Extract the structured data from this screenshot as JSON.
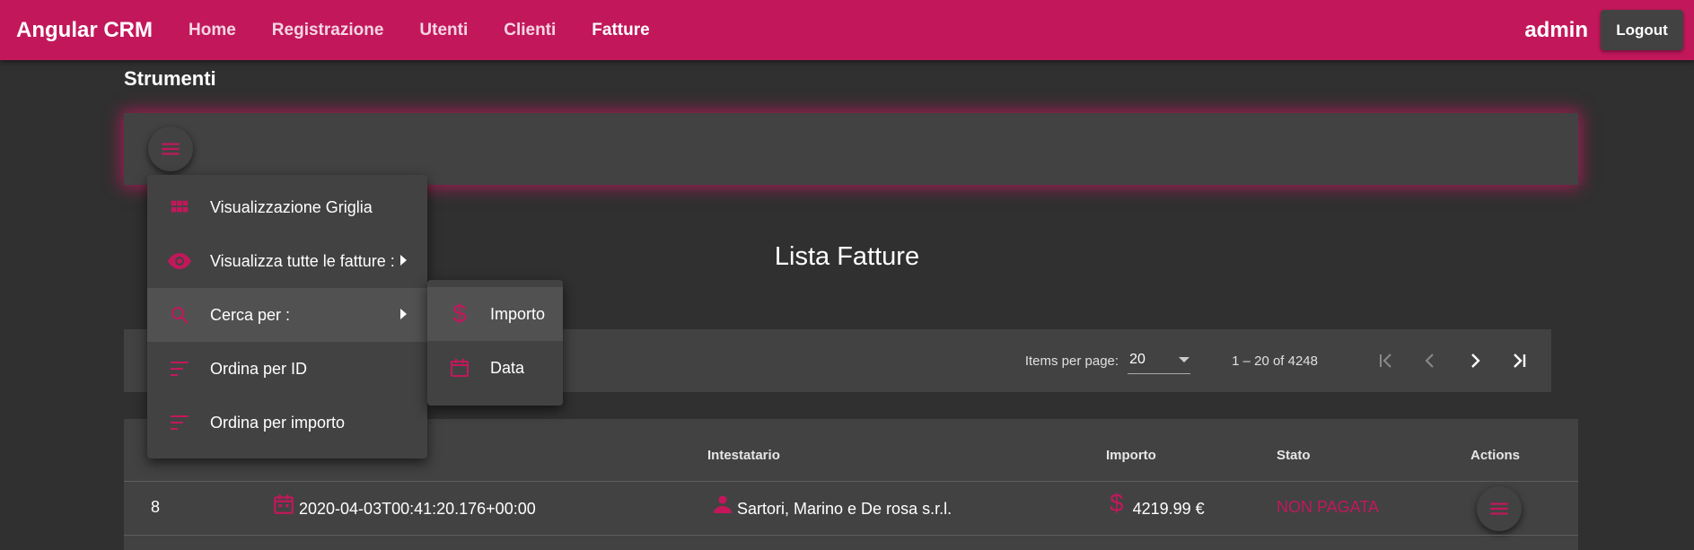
{
  "app": {
    "title": "Angular CRM"
  },
  "nav": {
    "items": [
      {
        "label": "Home"
      },
      {
        "label": "Registrazione"
      },
      {
        "label": "Utenti"
      },
      {
        "label": "Clienti"
      },
      {
        "label": "Fatture"
      }
    ],
    "active": "Fatture"
  },
  "user": {
    "name": "admin",
    "logout_label": "Logout"
  },
  "tools": {
    "title": "Strumenti",
    "menu_icon": "menu-icon"
  },
  "menu": {
    "items": [
      {
        "label": "Visualizzazione Griglia",
        "icon": "grid-icon"
      },
      {
        "label": "Visualizza tutte le fatture :",
        "icon": "eye-icon",
        "has_submenu": true
      },
      {
        "label": "Cerca per :",
        "icon": "search-icon",
        "has_submenu": true
      },
      {
        "label": "Ordina per ID",
        "icon": "sort-icon"
      },
      {
        "label": "Ordina per importo",
        "icon": "sort-icon"
      }
    ],
    "submenu": [
      {
        "label": "Importo",
        "icon": "dollar-icon"
      },
      {
        "label": "Data",
        "icon": "calendar-icon"
      }
    ]
  },
  "list": {
    "title": "Lista Fatture"
  },
  "paginator": {
    "items_per_page_label": "Items per page:",
    "items_per_page_value": "20",
    "range": "1 – 20 of 4248"
  },
  "table": {
    "headers": {
      "intestatario": "Intestatario",
      "importo": "Importo",
      "stato": "Stato",
      "actions": "Actions"
    },
    "rows": [
      {
        "id": "8",
        "date": "2020-04-03T00:41:20.176+00:00",
        "holder": "Sartori, Marino e De rosa s.r.l.",
        "amount": "4219.99 €",
        "status": "NON PAGATA"
      }
    ]
  },
  "colors": {
    "accent": "#c2185b",
    "background": "#303030",
    "surface": "#424242"
  }
}
